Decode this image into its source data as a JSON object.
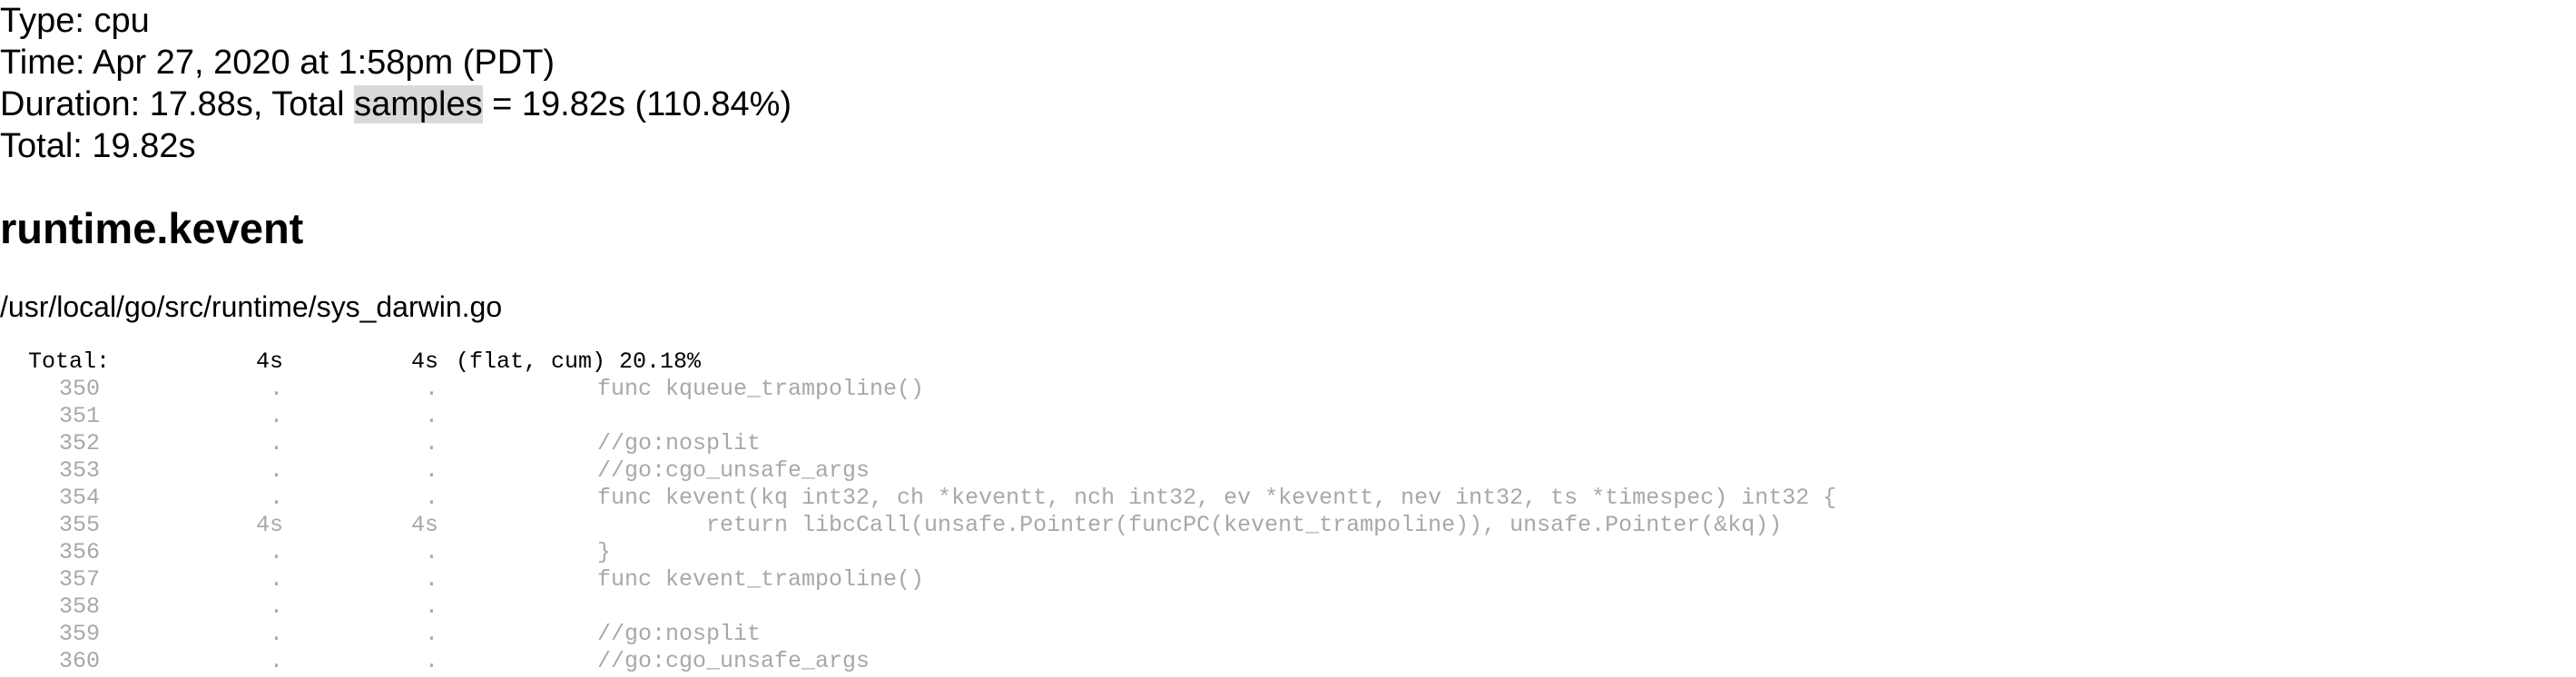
{
  "header": {
    "type_line": "Type: cpu",
    "time_line": "Time: Apr 27, 2020 at 1:58pm (PDT)",
    "duration_prefix": "Duration: 17.88s, Total ",
    "duration_highlight": "samples",
    "duration_suffix": " = 19.82s (110.84%)",
    "total_line": "Total: 19.82s"
  },
  "function": {
    "name": "runtime.kevent",
    "file": "/usr/local/go/src/runtime/sys_darwin.go"
  },
  "listing": {
    "total_label": "Total:",
    "total_flat": "4s",
    "total_cum": "4s",
    "total_suffix": "(flat, cum) 20.18%",
    "lines": [
      {
        "num": "350",
        "flat": ".",
        "cum": ".",
        "code": "func kqueue_trampoline()"
      },
      {
        "num": "351",
        "flat": ".",
        "cum": ".",
        "code": ""
      },
      {
        "num": "352",
        "flat": ".",
        "cum": ".",
        "code": "//go:nosplit"
      },
      {
        "num": "353",
        "flat": ".",
        "cum": ".",
        "code": "//go:cgo_unsafe_args"
      },
      {
        "num": "354",
        "flat": ".",
        "cum": ".",
        "code": "func kevent(kq int32, ch *keventt, nch int32, ev *keventt, nev int32, ts *timespec) int32 {"
      },
      {
        "num": "355",
        "flat": "4s",
        "cum": "4s",
        "code": "        return libcCall(unsafe.Pointer(funcPC(kevent_trampoline)), unsafe.Pointer(&kq))"
      },
      {
        "num": "356",
        "flat": ".",
        "cum": ".",
        "code": "}"
      },
      {
        "num": "357",
        "flat": ".",
        "cum": ".",
        "code": "func kevent_trampoline()"
      },
      {
        "num": "358",
        "flat": ".",
        "cum": ".",
        "code": ""
      },
      {
        "num": "359",
        "flat": ".",
        "cum": ".",
        "code": "//go:nosplit"
      },
      {
        "num": "360",
        "flat": ".",
        "cum": ".",
        "code": "//go:cgo_unsafe_args"
      }
    ]
  }
}
